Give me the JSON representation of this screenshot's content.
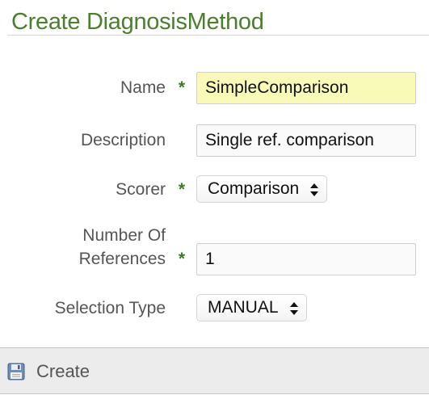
{
  "header": {
    "title": "Create DiagnosisMethod"
  },
  "form": {
    "name": {
      "label": "Name",
      "required_marker": "*",
      "value": "SimpleComparison"
    },
    "description": {
      "label": "Description",
      "value": "Single ref. comparison"
    },
    "scorer": {
      "label": "Scorer",
      "required_marker": "*",
      "selected": "Comparison"
    },
    "number_of_references": {
      "label_line1": "Number Of",
      "label_line2": "References",
      "required_marker": "*",
      "value": "1"
    },
    "selection_type": {
      "label": "Selection Type",
      "selected": "MANUAL"
    }
  },
  "footer": {
    "create_label": "Create",
    "create_icon": "save-icon"
  },
  "colors": {
    "title": "#4a7f2e",
    "required": "#3d7a22",
    "highlight_field": "#fafab8",
    "footer_bg": "#ececec"
  }
}
